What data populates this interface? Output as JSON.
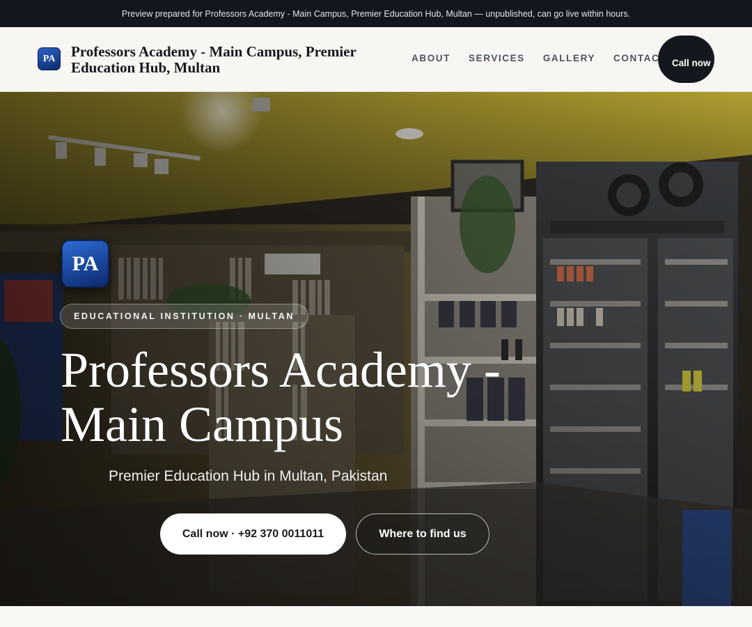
{
  "banner": {
    "text": "Preview prepared for Professors Academy - Main Campus, Premier Education Hub, Multan — unpublished, can go live within hours."
  },
  "header": {
    "logo_initials": "PA",
    "brand_name": "Professors Academy - Main Campus, Premier Education Hub, Multan",
    "nav": [
      "ABOUT",
      "SERVICES",
      "GALLERY",
      "CONTACT"
    ],
    "call_label": "Call now"
  },
  "hero": {
    "logo_initials": "PA",
    "eyebrow": "EDUCATIONAL INSTITUTION · MULTAN",
    "title": "Professors Academy - Main Campus",
    "subtitle": "Premier Education Hub in Multan, Pakistan",
    "cta_primary": "Call now · +92 370 0011011",
    "cta_secondary": "Where to find us"
  },
  "colors": {
    "banner_bg": "#12161e",
    "header_bg": "#f7f6f3",
    "dark_button": "#14171d",
    "logo_blue": "#1f4fb0"
  }
}
